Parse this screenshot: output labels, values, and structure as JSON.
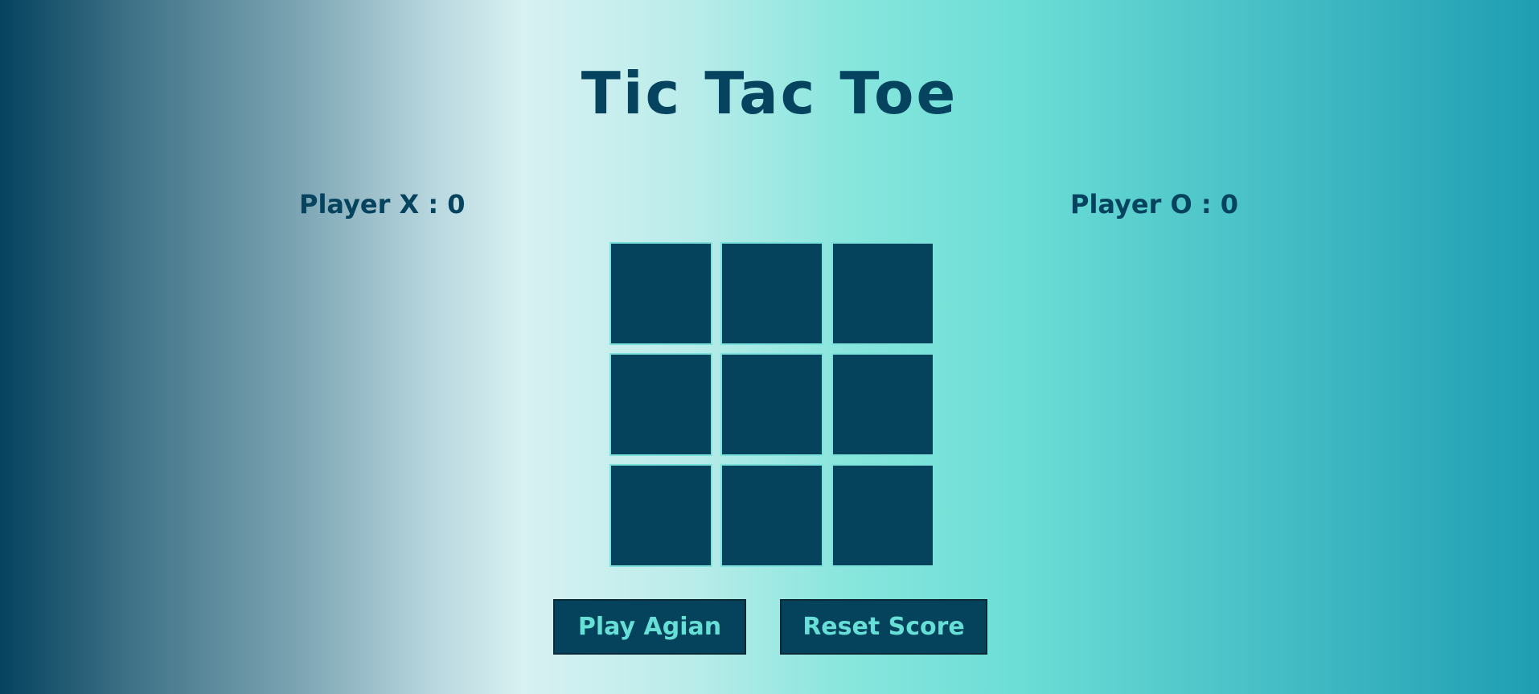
{
  "title": "Tic Tac Toe",
  "scores": {
    "x_label": "Player X : 0",
    "o_label": "Player O : 0"
  },
  "board": {
    "cells": [
      "",
      "",
      "",
      "",
      "",
      "",
      "",
      "",
      ""
    ]
  },
  "buttons": {
    "play_again": "Play Agian",
    "reset_score": "Reset Score"
  },
  "colors": {
    "primary": "#05425c",
    "accent": "#66dfd6",
    "cell_border": "#7ce3dc"
  }
}
